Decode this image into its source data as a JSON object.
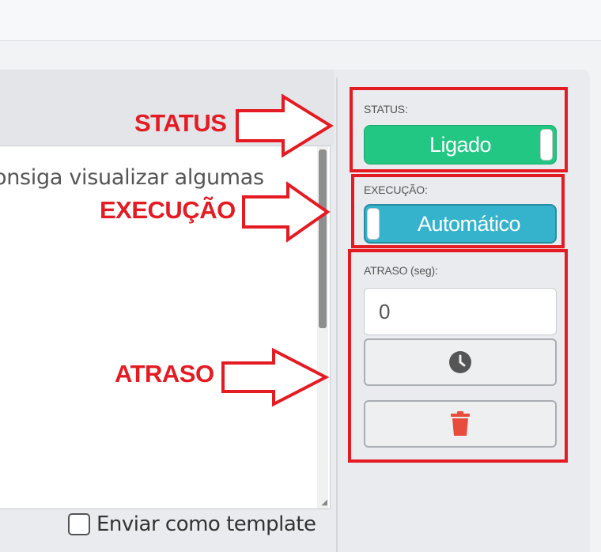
{
  "editor": {
    "text": "onsiga visualizar algumas",
    "send_as_template_label": "Enviar como template"
  },
  "sidebar": {
    "status": {
      "label": "STATUS:",
      "value": "Ligado",
      "color": "#22c784"
    },
    "execution": {
      "label": "EXECUÇÃO:",
      "value": "Automático",
      "color": "#35b3cc"
    },
    "delay": {
      "label": "ATRASO (seg):",
      "value": "0",
      "clock_icon": "clock-icon",
      "trash_icon": "trash-icon",
      "trash_color": "#e74c3c"
    }
  },
  "annotations": {
    "color": "#e41b23",
    "status": "STATUS",
    "execution": "EXECUÇÃO",
    "delay": "ATRASO"
  }
}
